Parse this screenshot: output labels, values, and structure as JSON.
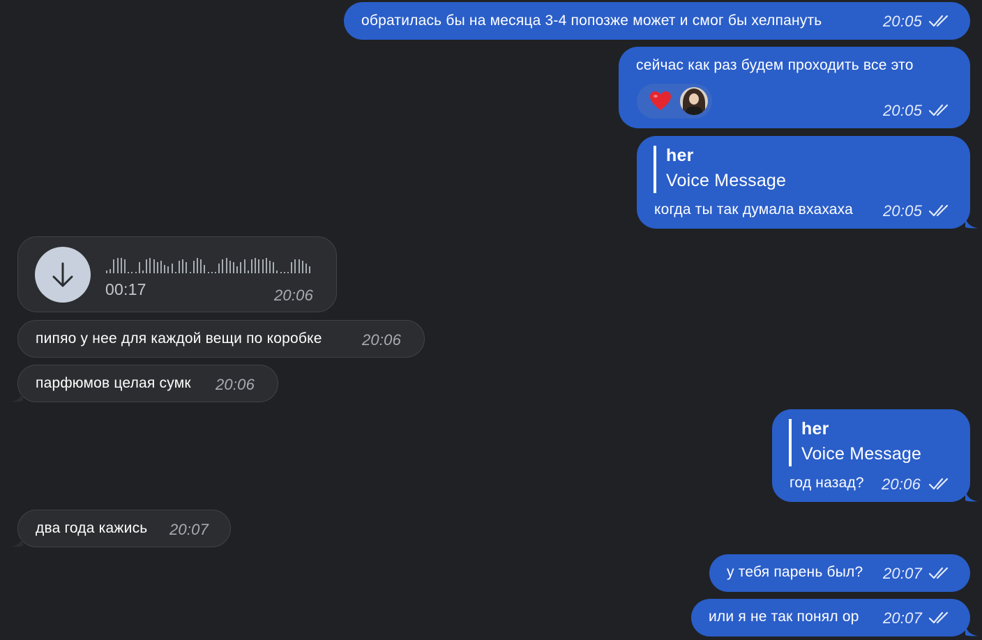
{
  "messages": [
    {
      "text": "обратилась бы на месяца 3-4 попозже может и смог бы хелпануть",
      "time": "20:05"
    },
    {
      "text": "сейчас как раз будем проходить все это",
      "time": "20:05",
      "reactions": [
        "heart-emoji",
        "avatar"
      ]
    },
    {
      "reply_name": "her",
      "reply_text": "Voice Message",
      "text": "когда ты так думала вхахаха",
      "time": "20:05"
    },
    {
      "duration": "00:17",
      "time": "20:06"
    },
    {
      "text": "пипяо у нее для каждой вещи по коробке",
      "time": "20:06"
    },
    {
      "text": "парфюмов целая сумк",
      "time": "20:06"
    },
    {
      "reply_name": "her",
      "reply_text": "Voice Message",
      "text": "год назад?",
      "time": "20:06"
    },
    {
      "text": "два года кажись",
      "time": "20:07"
    },
    {
      "text": "у тебя парень был?",
      "time": "20:07"
    },
    {
      "text": "или я не так понял ор",
      "time": "20:07"
    }
  ],
  "voice": {
    "waveform": [
      4,
      6,
      20,
      22,
      22,
      20,
      2,
      2,
      2,
      16,
      4,
      20,
      22,
      20,
      16,
      18,
      12,
      10,
      14,
      2,
      18,
      20,
      16,
      2,
      18,
      22,
      20,
      12,
      2,
      2,
      2,
      14,
      20,
      22,
      18,
      16,
      10,
      16,
      20,
      4,
      20,
      22,
      20,
      20,
      22,
      18,
      16,
      4,
      2,
      2,
      2,
      16,
      20,
      20,
      18,
      14,
      10
    ]
  },
  "colors": {
    "background": "#1f2124",
    "outgoing": "#2a5ec9",
    "incoming": "#2b2d30",
    "heart": "#e5262f"
  },
  "icons": {
    "read": "double-check-icon",
    "download": "download-arrow-icon"
  }
}
